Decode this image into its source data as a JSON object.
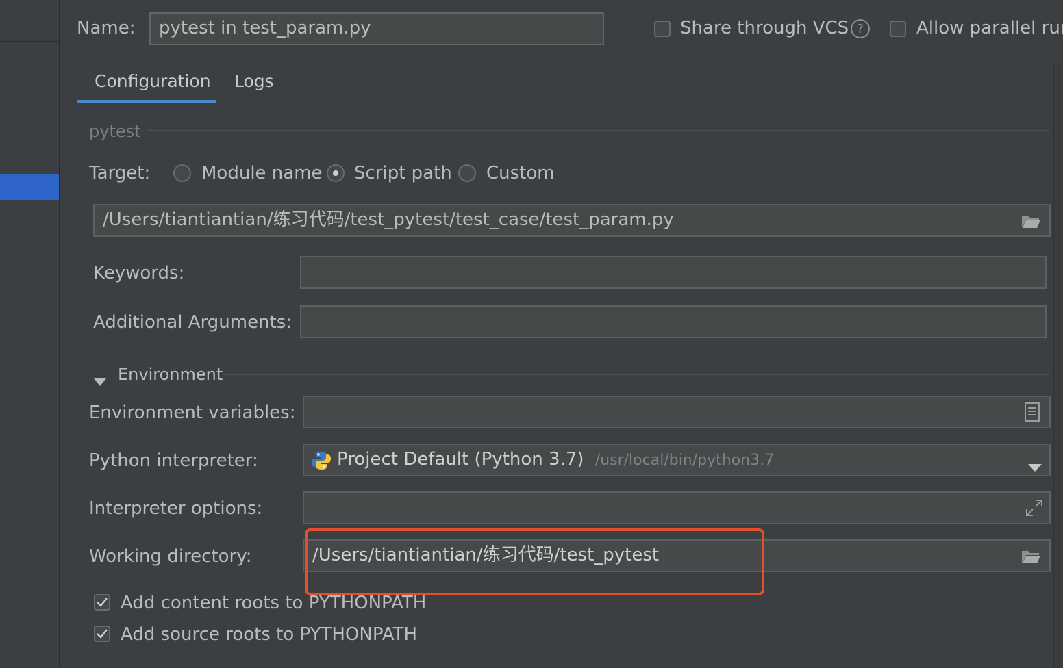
{
  "header": {
    "name_label": "Name:",
    "name_value": "pytest in test_param.py",
    "share_label": "Share through VCS",
    "share_checked": false,
    "help_glyph": "?",
    "parallel_label": "Allow parallel rur",
    "parallel_checked": false
  },
  "tabs": [
    {
      "label": "Configuration",
      "active": true
    },
    {
      "label": "Logs",
      "active": false
    }
  ],
  "section": {
    "title": "pytest"
  },
  "target": {
    "label": "Target:",
    "options": [
      {
        "label": "Module name",
        "selected": false
      },
      {
        "label": "Script path",
        "selected": true
      },
      {
        "label": "Custom",
        "selected": false
      }
    ],
    "path_value": "/Users/tiantiantian/练习代码/test_pytest/test_case/test_param.py"
  },
  "keywords": {
    "label": "Keywords:",
    "value": ""
  },
  "additional_args": {
    "label": "Additional Arguments:",
    "value": ""
  },
  "environment": {
    "title": "Environment",
    "env_vars_label": "Environment variables:",
    "env_vars_value": "",
    "interpreter_label": "Python interpreter:",
    "interpreter_name": "Project Default (Python 3.7)",
    "interpreter_path": "/usr/local/bin/python3.7",
    "interp_options_label": "Interpreter options:",
    "interp_options_value": "",
    "working_dir_label": "Working directory:",
    "working_dir_value": "/Users/tiantiantian/练习代码/test_pytest"
  },
  "checks": [
    {
      "label": "Add content roots to PYTHONPATH",
      "checked": true
    },
    {
      "label": "Add source roots to PYTHONPATH",
      "checked": true
    }
  ],
  "colors": {
    "background": "#3c3f41",
    "field": "#45494a",
    "accent": "#4a88c7",
    "selection": "#2f65ca",
    "highlight": "#e0502c"
  },
  "icons": {
    "folder": "folder-icon",
    "env": "document-list-icon",
    "dropdown": "chevron-down-icon",
    "expand": "expand-icon",
    "python": "python-icon",
    "help": "help-icon"
  }
}
